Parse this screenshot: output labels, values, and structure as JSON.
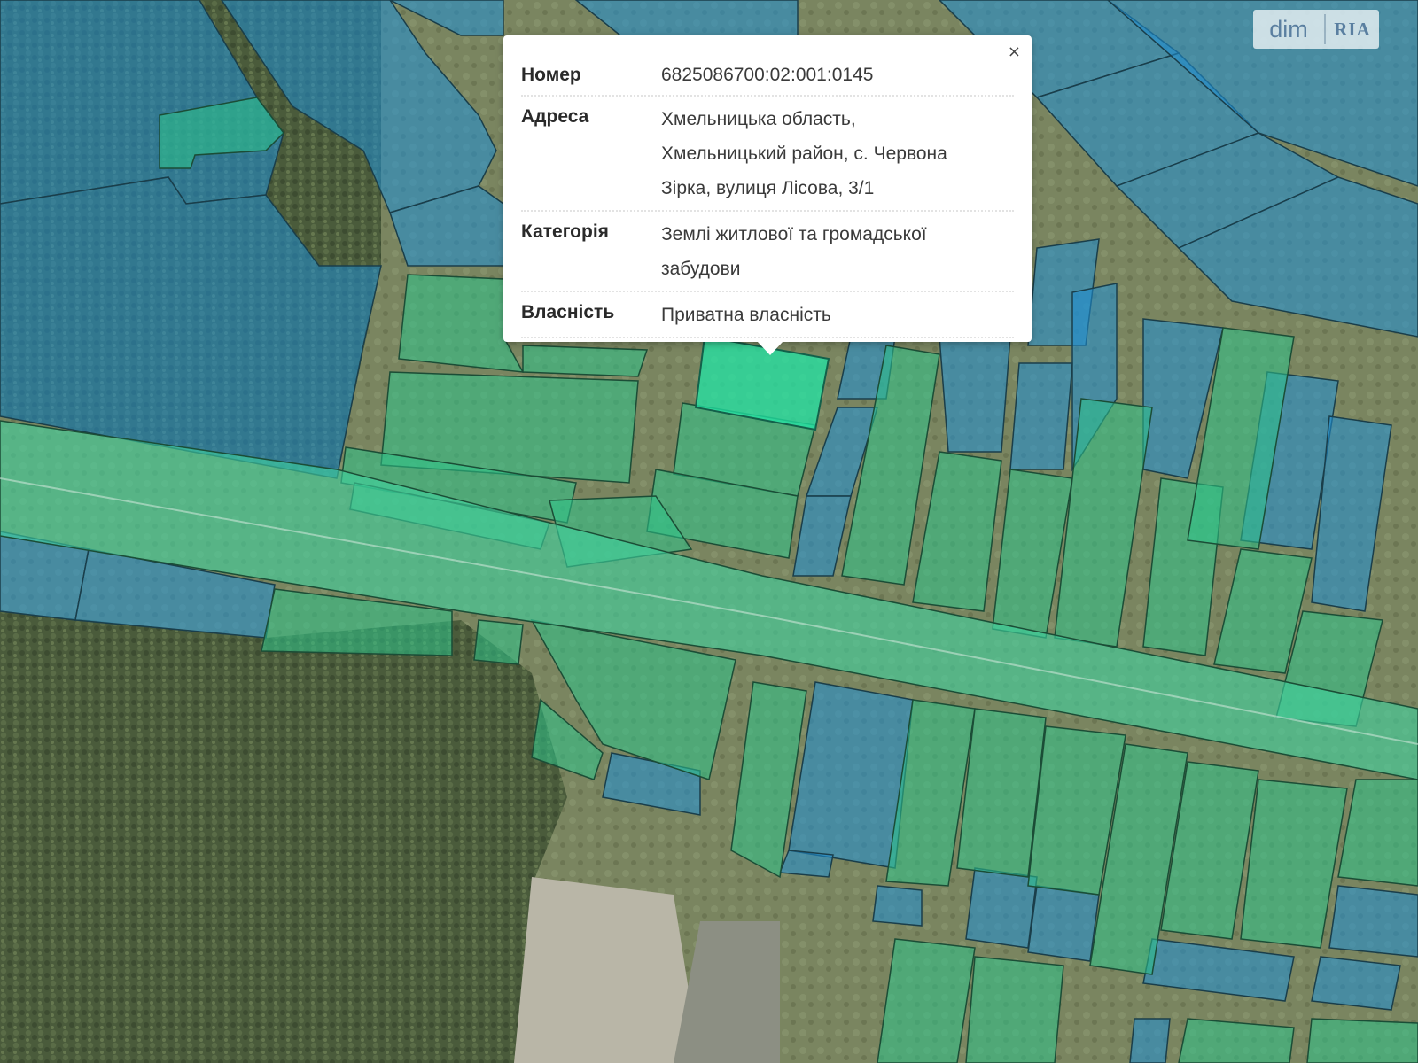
{
  "popup": {
    "close_label": "×",
    "rows": [
      {
        "key": "Номер",
        "lines": [
          "6825086700:02:001:0145"
        ]
      },
      {
        "key": "Адреса",
        "lines": [
          "Хмельницька область,",
          "Хмельницький район, с. Червона",
          "Зірка, вулиця Лісова, 3/1"
        ]
      },
      {
        "key": "Категорія",
        "lines": [
          "Землі житлової та громадської",
          "забудови"
        ]
      },
      {
        "key": "Власність",
        "lines": [
          "Приватна власність"
        ]
      }
    ]
  },
  "logo": {
    "dim": "dim",
    "ria": "RIA"
  },
  "colors": {
    "parcel_green": "#2ec48a",
    "parcel_blue": "#1f8fd6",
    "parcel_selected": "#22e6a6",
    "forest": "#4d5e3e",
    "field": "#7b8862",
    "road": "#b7c2b0"
  }
}
